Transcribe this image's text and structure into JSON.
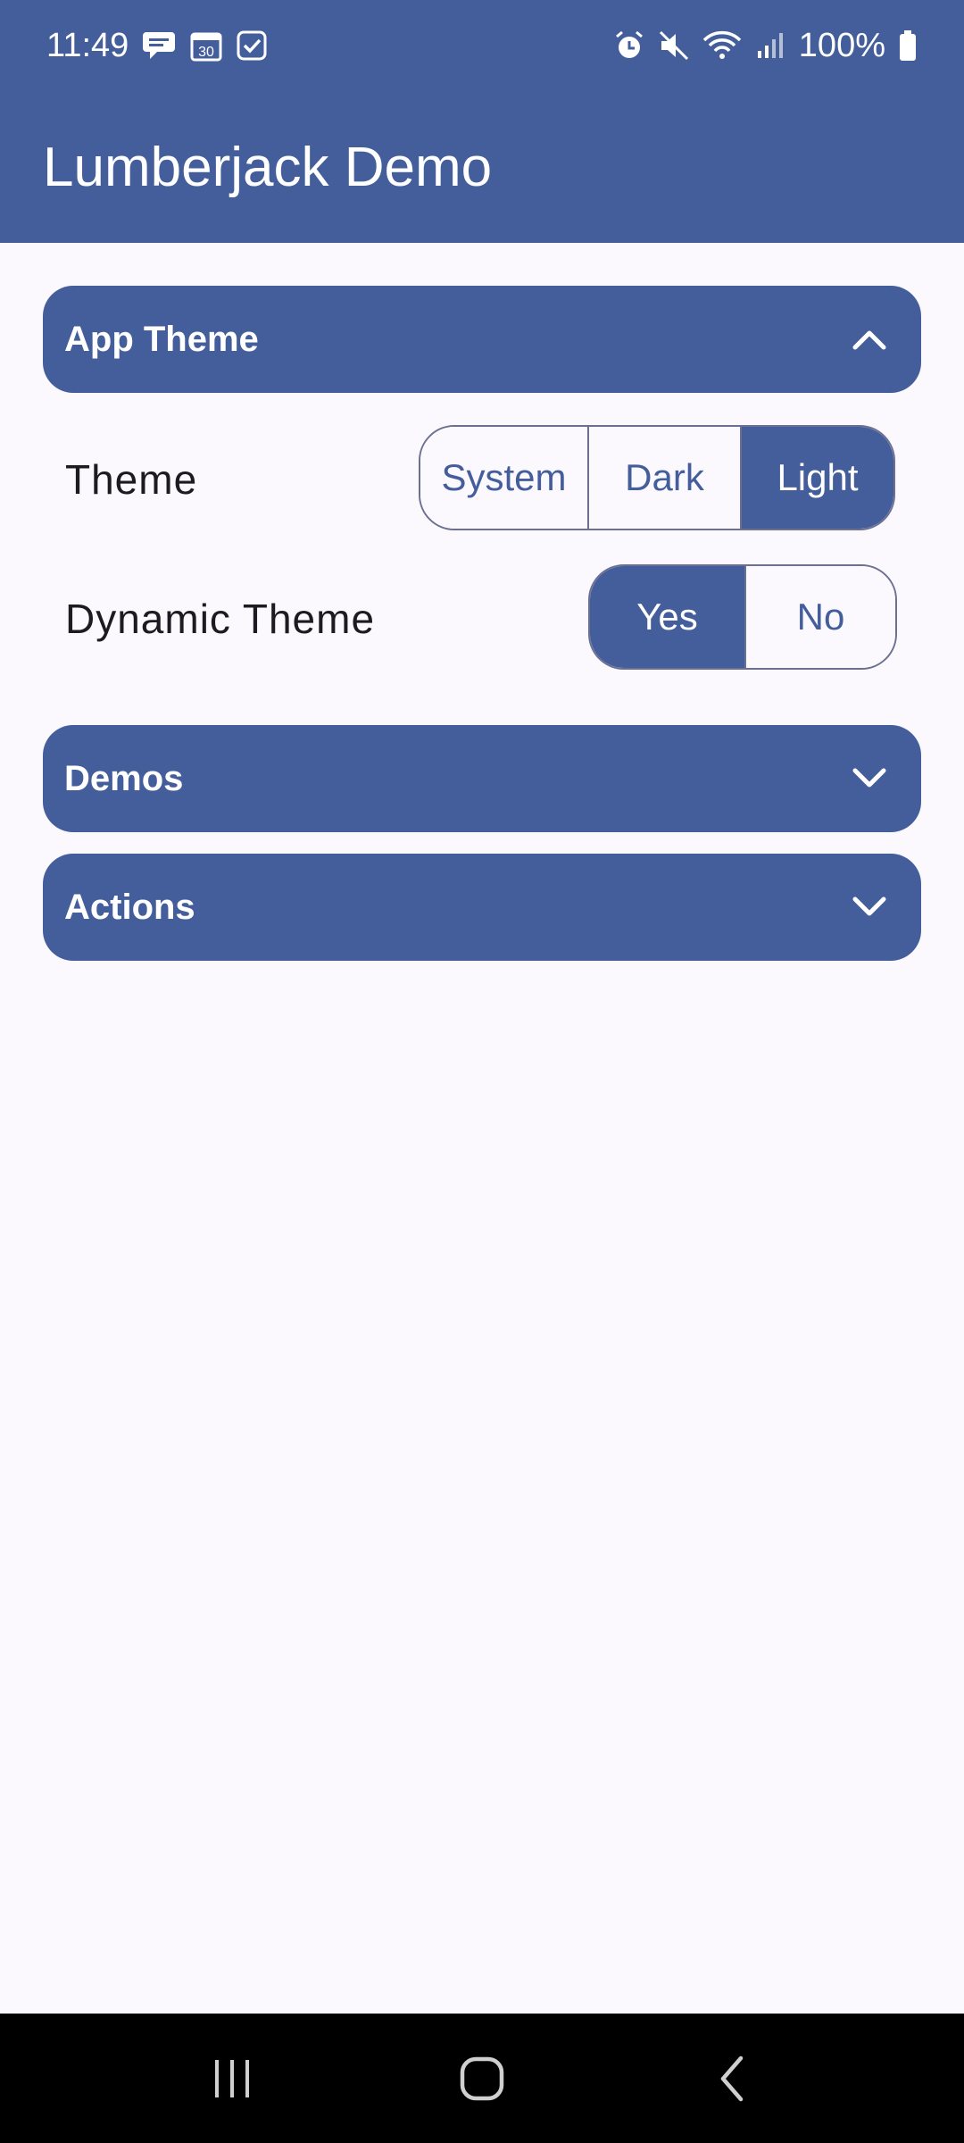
{
  "status_bar": {
    "time": "11:49",
    "battery": "100%",
    "left_icons": [
      "chat-bubble-icon",
      "calendar-icon",
      "checkbox-icon"
    ],
    "calendar_day": "30",
    "right_icons": [
      "alarm-icon",
      "mute-icon",
      "wifi-icon",
      "signal-icon",
      "battery-icon"
    ]
  },
  "app_bar": {
    "title": "Lumberjack Demo"
  },
  "sections": {
    "app_theme": {
      "title": "App Theme",
      "expanded": true,
      "theme_row": {
        "label": "Theme",
        "options": [
          "System",
          "Dark",
          "Light"
        ],
        "selected": "Light"
      },
      "dynamic_row": {
        "label": "Dynamic Theme",
        "options": [
          "Yes",
          "No"
        ],
        "selected": "Yes"
      }
    },
    "demos": {
      "title": "Demos",
      "expanded": false
    },
    "actions": {
      "title": "Actions",
      "expanded": false
    }
  },
  "colors": {
    "primary": "#445e9b",
    "background": "#fbf8fe",
    "on_primary": "#ffffff",
    "text": "#1b1b21",
    "outline": "#6b7090"
  },
  "nav_bar": {
    "buttons": [
      "recent-apps-icon",
      "home-icon",
      "back-icon"
    ]
  }
}
